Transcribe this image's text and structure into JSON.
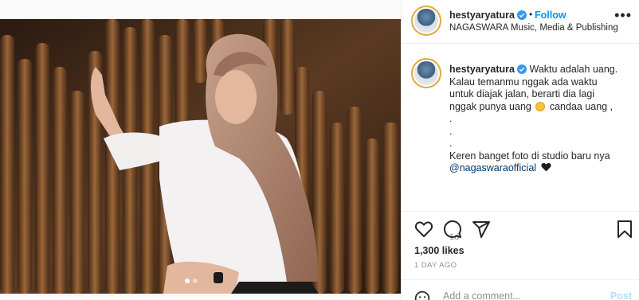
{
  "post": {
    "username": "hestyaryatura",
    "follow_label": "Follow",
    "separator": "•",
    "location": "NAGASWARA Music, Media & Publishing",
    "more_label": "•••",
    "photo_description_icon": "wood-panel-photo",
    "carousel": {
      "total": 2,
      "active": 1
    }
  },
  "caption": {
    "username": "hestyaryatura",
    "line1": "Waktu adalah uang.",
    "line2": "Kalau temanmu nggak ada waktu",
    "line3": "untuk diajak jalan, berarti dia lagi",
    "line4a": "nggak punya uang",
    "line4b": "candaa uang ,",
    "line5": ".",
    "line6": ".",
    "line7": ".",
    "line8": "Keren banget foto di studio baru nya",
    "mention": "@nagaswaraofficial",
    "timestamp": "1d"
  },
  "actions": {
    "likes": "1,300 likes",
    "age": "1 DAY AGO",
    "icons": [
      "heart-icon",
      "comment-icon",
      "share-icon",
      "bookmark-icon"
    ]
  },
  "add_comment": {
    "placeholder": "Add a comment...",
    "post_label": "Post"
  },
  "colors": {
    "accent": "#0095f6",
    "verified": "#3897f0",
    "avatar_ring": "#e1a83c",
    "post_disabled": "#b2dffc"
  }
}
